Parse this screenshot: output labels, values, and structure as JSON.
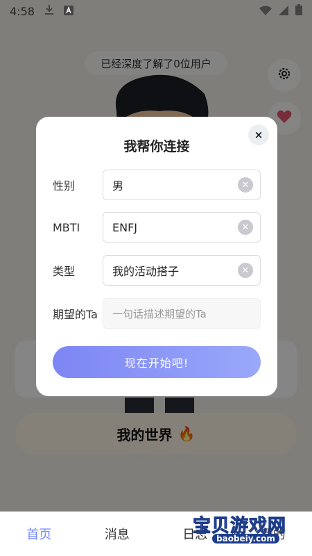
{
  "status_bar": {
    "time": "4:58"
  },
  "hero": {
    "pill_text": "已经深度了解了0位用户"
  },
  "main": {
    "world_label": "我的世界",
    "world_emoji": "🔥"
  },
  "bottom_nav": {
    "items": [
      {
        "label": "首页",
        "active": true
      },
      {
        "label": "消息"
      },
      {
        "label": "日志"
      },
      {
        "label": "我的"
      }
    ]
  },
  "modal": {
    "title": "我帮你连接",
    "close_glyph": "×",
    "fields": [
      {
        "label": "性别",
        "value": "男"
      },
      {
        "label": "MBTI",
        "value": "ENFJ"
      },
      {
        "label": "类型",
        "value": "我的活动搭子"
      },
      {
        "label": "期望的Ta",
        "value": "",
        "placeholder": "一句话描述期望的Ta"
      }
    ],
    "submit_label": "现在开始吧!"
  },
  "watermark": {
    "title": "宝贝游戏网",
    "url": "baobeiy.com"
  },
  "colors": {
    "accent": "#6f86ff",
    "button_gradient_start": "#7d86f4",
    "button_gradient_end": "#9aa8fa"
  },
  "icons": [
    "download-icon",
    "a-box-icon",
    "wifi-icon",
    "signal-icon",
    "battery-icon",
    "gear-icon",
    "heart-badge-icon",
    "close-icon",
    "clear-icon"
  ]
}
